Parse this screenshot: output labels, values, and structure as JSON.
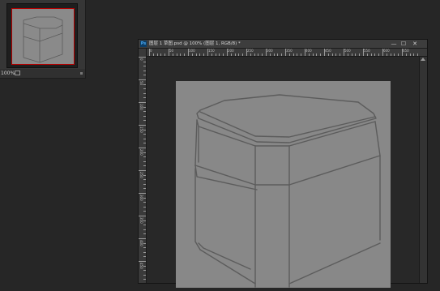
{
  "navigator": {
    "zoom": "100%"
  },
  "document": {
    "app_icon": "Ps",
    "title": "图层 1 草图.psd @ 100% (图层 1, RGB/8) *",
    "buttons": {
      "minimize": "—",
      "maximize": "☐",
      "close": "✕"
    }
  },
  "rulers": {
    "horizontal": [
      "0",
      "50",
      "100",
      "150",
      "200",
      "250",
      "300",
      "350",
      "400",
      "450",
      "500",
      "550",
      "600",
      "650"
    ],
    "vertical": [
      "0",
      "50",
      "100",
      "150",
      "200",
      "250",
      "300",
      "350",
      "400",
      "450",
      "500"
    ]
  },
  "icons": {
    "app": "photoshop-icon",
    "nav_zoom": "zoom-out-icon",
    "scroll": "scroll-up-arrow-icon"
  },
  "colors": {
    "canvas": "#888888",
    "workspace": "#262626",
    "sketch": "#5c5c5c",
    "navigator_frame": "#b30000"
  }
}
